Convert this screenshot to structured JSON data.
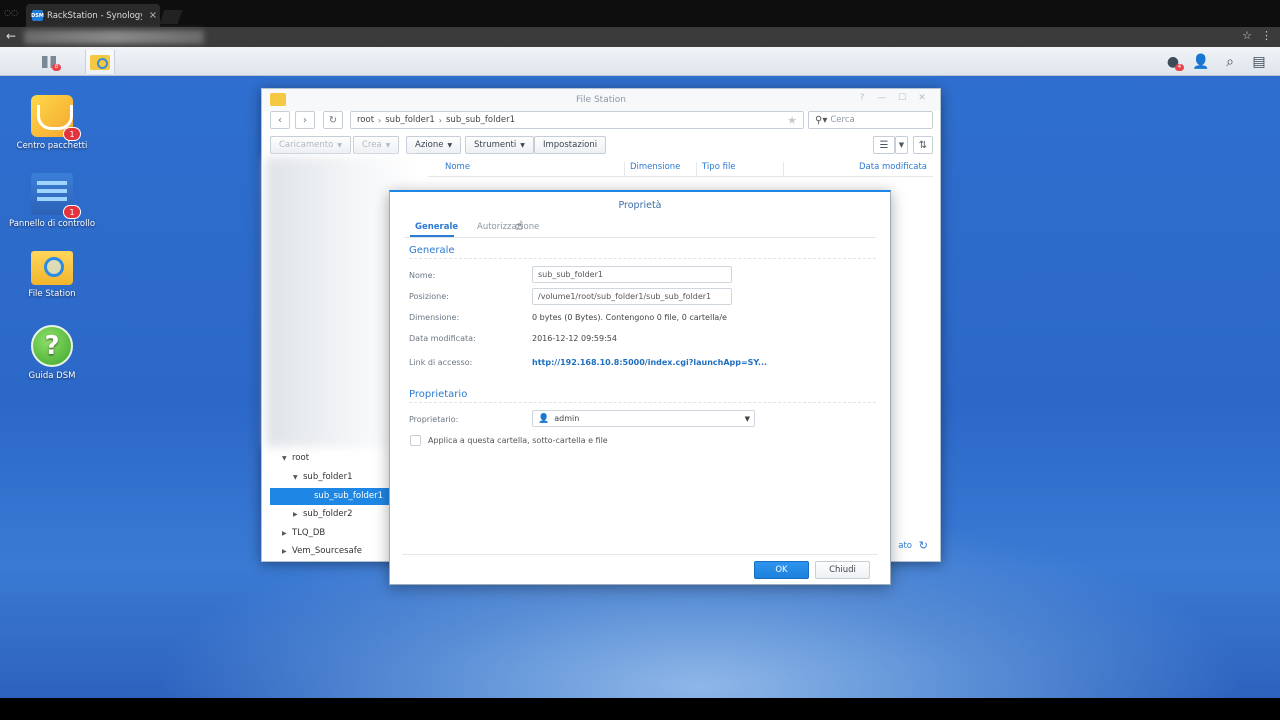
{
  "browser": {
    "tab_title": "RackStation - Synology I",
    "favicon_text": "DSM",
    "tab_close": "×"
  },
  "taskbar": {
    "main_badge": "8",
    "notif_badge": "4"
  },
  "desktop_icons": [
    {
      "label": "Centro pacchetti",
      "badge": "1",
      "icon": "package-center-icon"
    },
    {
      "label": "Pannello di controllo",
      "badge": "1",
      "icon": "control-panel-icon"
    },
    {
      "label": "File Station",
      "badge": "",
      "icon": "file-station-icon"
    },
    {
      "label": "Guida DSM",
      "badge": "",
      "icon": "help-icon",
      "glyph": "?"
    }
  ],
  "file_station": {
    "title": "File Station",
    "path": [
      "root",
      "sub_folder1",
      "sub_sub_folder1"
    ],
    "search_placeholder": "Cerca",
    "toolbar": {
      "upload": "Caricamento",
      "create": "Crea",
      "action": "Azione",
      "tools": "Strumenti",
      "settings": "Impostazioni"
    },
    "columns": [
      "Nome",
      "Dimensione",
      "Tipo file",
      "Data modificata"
    ],
    "tree": {
      "root": "root",
      "sub_folder1": "sub_folder1",
      "sub_sub_folder1": "sub_sub_folder1",
      "sub_folder2": "sub_folder2",
      "tlq_db": "TLQ_DB",
      "vem": "Vem_Sourcesafe"
    },
    "status_text": "ato"
  },
  "dialog": {
    "title": "Proprietà",
    "tabs": [
      "Generale",
      "Autorizzazione"
    ],
    "section_general": "Generale",
    "fields": {
      "name_label": "Nome:",
      "name_value": "sub_sub_folder1",
      "location_label": "Posizione:",
      "location_value": "/volume1/root/sub_folder1/sub_sub_folder1",
      "size_label": "Dimensione:",
      "size_value": "0 bytes (0 Bytes). Contengono 0 file, 0 cartella/e",
      "modified_label": "Data modificata:",
      "modified_value": "2016-12-12 09:59:54",
      "link_label": "Link di accesso:",
      "link_value": "http://192.168.10.8:5000/index.cgi?launchApp=SY..."
    },
    "section_owner": "Proprietario",
    "owner_label": "Proprietario:",
    "owner_value": "admin",
    "apply_label": "Applica a questa cartella, sotto-cartella e file",
    "ok": "OK",
    "close": "Chiudi"
  }
}
